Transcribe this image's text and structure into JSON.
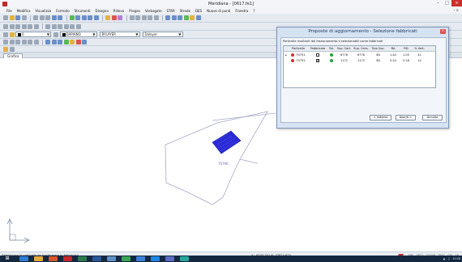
{
  "window": {
    "title": "Meridiana - [0617.fe1]",
    "minimize_icon": "minimize-icon",
    "restore_icon": "restore-icon",
    "close_icon": "close-icon"
  },
  "menubar": {
    "items": [
      "File",
      "Modifica",
      "Visualizza",
      "Formato",
      "Strumenti",
      "Disegna",
      "Rilievo",
      "Pregeo",
      "Verbagate",
      "STAR",
      "Strade",
      "DES",
      "Nuove di punti",
      "Finestra",
      "?"
    ],
    "right_label": "-  ×"
  },
  "toolbar": {
    "layer": "0",
    "color": "DAPIANO",
    "linetype": "BYLAYER",
    "lineweight": "Dalayer"
  },
  "tabs": {
    "active": "Grafica"
  },
  "canvas": {
    "parcel_label": "70796"
  },
  "dialog": {
    "title": "Proposte di aggiornamento - Selezione fabbricati",
    "description": "Particelle risultanti dal frazionamento e selezionabili come fabbricati",
    "columns": [
      "",
      "Particella",
      "Fabbricato",
      "Tot.",
      "Sup. Cart.",
      "Sup. Cens.",
      "Tipo Sup.",
      "BA",
      "RD",
      "% Vert."
    ],
    "rows": [
      {
        "particella": "70751",
        "fabbricato": "",
        "dot_color": "#d32f2f",
        "check_color": "#2e9e3b",
        "sup_cart": "6776",
        "sup_cens": "6778",
        "tipo_sup": "SN",
        "ba": "1.40",
        "rd": "1.05",
        "vert": "41"
      },
      {
        "particella": "70752",
        "fabbricato": "☒",
        "dot_color": "#d32f2f",
        "check_color": "#2e9e3b",
        "sup_cart": "1172",
        "sup_cens": "1172",
        "tipo_sup": "SN",
        "ba": "0.24",
        "rd": "0.18",
        "vert": "14"
      }
    ],
    "buttons": {
      "back": "< Indietro",
      "next": "Avanti >",
      "cancel": "Annulla"
    }
  },
  "statusbar": {
    "message": "Selezionare la particella da trasformare in fabbricato",
    "coords": "X: -6745.201  N: 37874.675",
    "flags": [
      "SPR",
      "ORTO",
      "OSNAP",
      "TRAC",
      "GRI",
      "LW"
    ]
  },
  "taskbar": {
    "start_icon": "windows-start-icon",
    "clock": "10:28"
  }
}
